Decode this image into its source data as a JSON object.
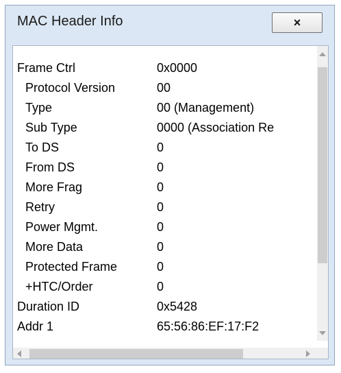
{
  "window": {
    "title": "MAC Header Info",
    "close_label": "×"
  },
  "fields": [
    {
      "label": "Frame Ctrl",
      "value": "0x0000",
      "indent": false
    },
    {
      "label": "Protocol Version",
      "value": "00",
      "indent": true
    },
    {
      "label": "Type",
      "value": "00 (Management)",
      "indent": true
    },
    {
      "label": "Sub Type",
      "value": "0000 (Association Re",
      "indent": true
    },
    {
      "label": "To DS",
      "value": "0",
      "indent": true
    },
    {
      "label": "From DS",
      "value": "0",
      "indent": true
    },
    {
      "label": "More Frag",
      "value": "0",
      "indent": true
    },
    {
      "label": "Retry",
      "value": "0",
      "indent": true
    },
    {
      "label": "Power Mgmt.",
      "value": "0",
      "indent": true
    },
    {
      "label": "More Data",
      "value": "0",
      "indent": true
    },
    {
      "label": "Protected Frame",
      "value": "0",
      "indent": true
    },
    {
      "label": "+HTC/Order",
      "value": "0",
      "indent": true
    },
    {
      "label": "Duration ID",
      "value": "0x5428",
      "indent": false
    },
    {
      "label": "Addr 1",
      "value": "65:56:86:EF:17:F2",
      "indent": false
    }
  ]
}
